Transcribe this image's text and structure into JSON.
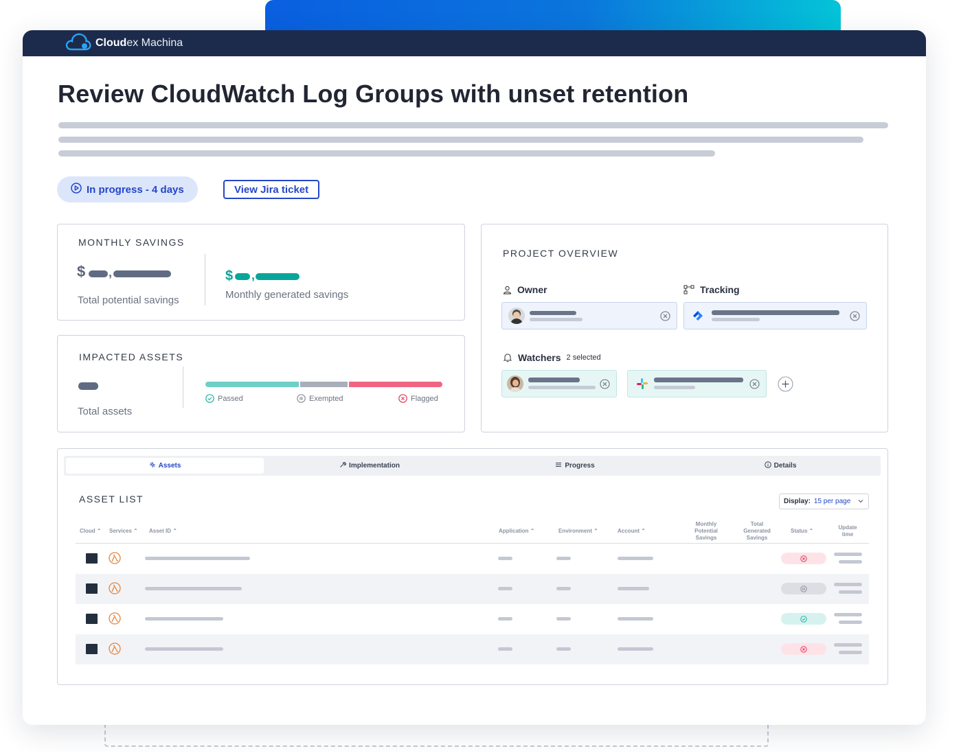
{
  "app": {
    "brand_bold": "Cloud",
    "brand_light": "ex Machina"
  },
  "page": {
    "title": "Review CloudWatch Log Groups with unset retention"
  },
  "status": {
    "label": "In progress - 4 days"
  },
  "actions": {
    "jira": "View Jira ticket"
  },
  "savings": {
    "title": "MONTHLY SAVINGS",
    "potential_symbol": "$",
    "potential_label": "Total potential savings",
    "generated_symbol": "$",
    "generated_label": "Monthly generated savings"
  },
  "impacted": {
    "title": "IMPACTED ASSETS",
    "total_label": "Total assets",
    "legend": [
      "Passed",
      "Exempted",
      "Flagged"
    ]
  },
  "overview": {
    "title": "PROJECT OVERVIEW",
    "owner_label": "Owner",
    "tracking_label": "Tracking",
    "watchers_label": "Watchers",
    "watchers_count": "2 selected"
  },
  "tabs": [
    "Assets",
    "Implementation",
    "Progress",
    "Details"
  ],
  "asset_list": {
    "title": "ASSET LIST",
    "display_label": "Display:",
    "display_value": "15 per page",
    "columns": {
      "cloud": "Cloud",
      "services": "Services",
      "asset_id": "Asset ID",
      "application": "Application",
      "environment": "Environment",
      "account": "Account",
      "monthly": [
        "Monthly",
        "Potential",
        "Savings"
      ],
      "total": [
        "Total",
        "Generated",
        "Savings"
      ],
      "status": "Status",
      "update": [
        "Update",
        "time"
      ]
    },
    "rows": [
      {
        "status": "flagged"
      },
      {
        "status": "exempted"
      },
      {
        "status": "passed"
      },
      {
        "status": "flagged"
      }
    ]
  },
  "colors": {
    "navy": "#1c2b4c",
    "accent": "#2446c8",
    "teal": "#0aa59a",
    "passed": "#6fd0c5",
    "exempted": "#a9aeb8",
    "flagged": "#f06582"
  }
}
